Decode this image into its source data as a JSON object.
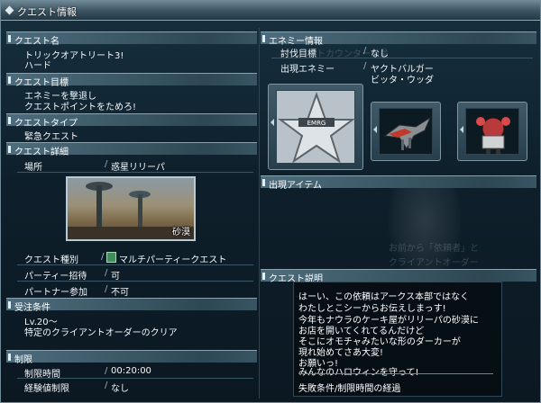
{
  "window": {
    "title": "クエスト情報"
  },
  "left": {
    "quest_name": {
      "header": "クエスト名",
      "name": "トリックオアトリート3!",
      "difficulty": "ハード"
    },
    "objective": {
      "header": "クエスト目標",
      "lines": [
        "エネミーを撃退し",
        "クエストポイントをためろ!"
      ]
    },
    "type": {
      "header": "クエストタイプ",
      "value": "緊急クエスト"
    },
    "details": {
      "header": "クエスト詳細",
      "location_label": "場所",
      "location_value": "惑星リリーパ",
      "thumbnail_caption": "砂漠",
      "kind_label": "クエスト種別",
      "kind_value": "マルチパーティークエスト",
      "party_invite_label": "パーティー招待",
      "party_invite_value": "可",
      "partner_label": "パートナー参加",
      "partner_value": "不可"
    },
    "requirements": {
      "header": "受注条件",
      "lines": [
        "Lv.20～",
        "特定のクライアントオーダーのクリア"
      ]
    },
    "limits": {
      "header": "制限",
      "time_label": "制限時間",
      "time_value": "00:20:00",
      "exp_label": "経験値制限",
      "exp_value": "なし"
    }
  },
  "right": {
    "enemy": {
      "header": "エネミー情報",
      "target_label": "討伐目標",
      "target_value": "なし",
      "appear_label": "出現エネミー",
      "appear_values": [
        "ヤクトバルガー",
        "ビッタ・ウッダ"
      ],
      "icons": [
        "emergency-star-icon",
        "yakt-barger-icon",
        "bitta-wooda-icon"
      ]
    },
    "items": {
      "header": "出現アイテム"
    },
    "description": {
      "header": "クエスト説明",
      "lines": [
        "はーい、この依頼はアークス本部ではなく",
        "わたしとこシーからお伝えしまっす!",
        "今年もナウラのケーキ屋がリリーパの砂漠に",
        "お店を開いてくれてるんだけど",
        "そこにオモチャみたいな形のダーカーが",
        "現れ始めてさあ大変!",
        "お願いっ!",
        "みんなのハロウィンを守って!"
      ],
      "fail_condition": "失敗条件/制限時間の経過"
    }
  },
  "colors": {
    "header_bg": "#4d6c7d",
    "window_bg": "#0e1f2b",
    "text": "#f4f7f9"
  }
}
